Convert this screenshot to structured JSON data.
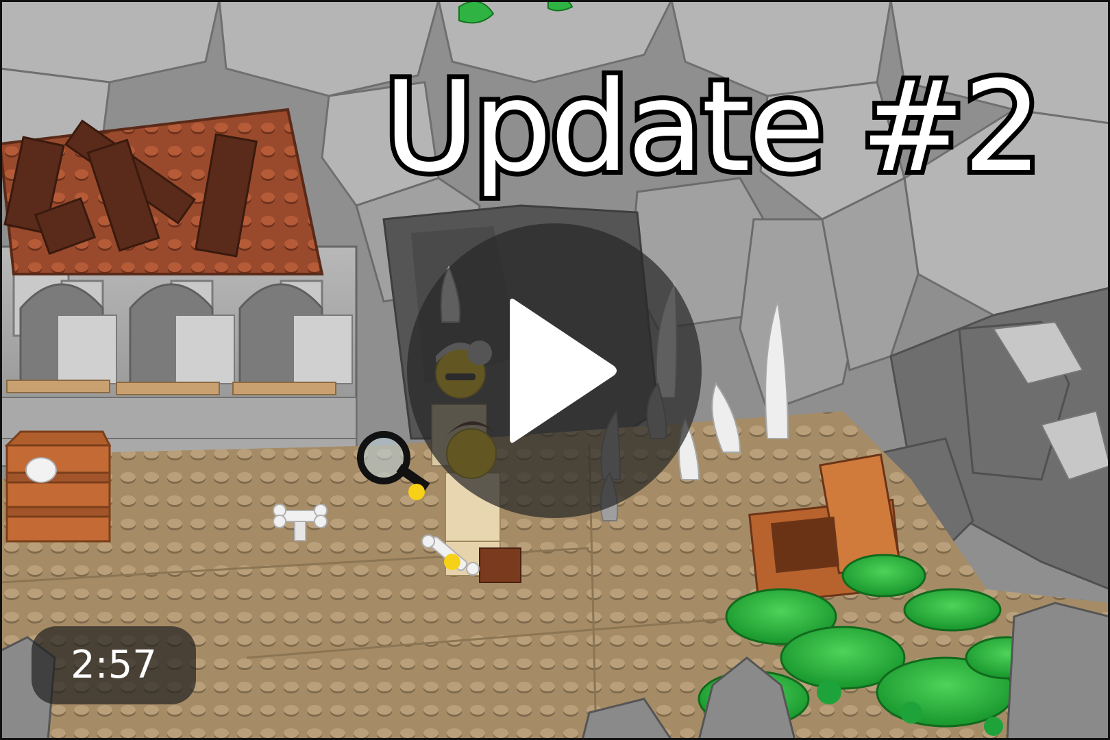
{
  "thumbnail": {
    "title": "Update #2",
    "duration": "2:57"
  },
  "icons": {
    "play": "play-icon"
  },
  "colors": {
    "title_fill": "#ffffff",
    "title_stroke": "#000000",
    "overlay": "#282828",
    "roof": "#9a4a2c",
    "ground": "#a58c67",
    "rock": "#9b9b9b",
    "plant": "#22b03a"
  }
}
